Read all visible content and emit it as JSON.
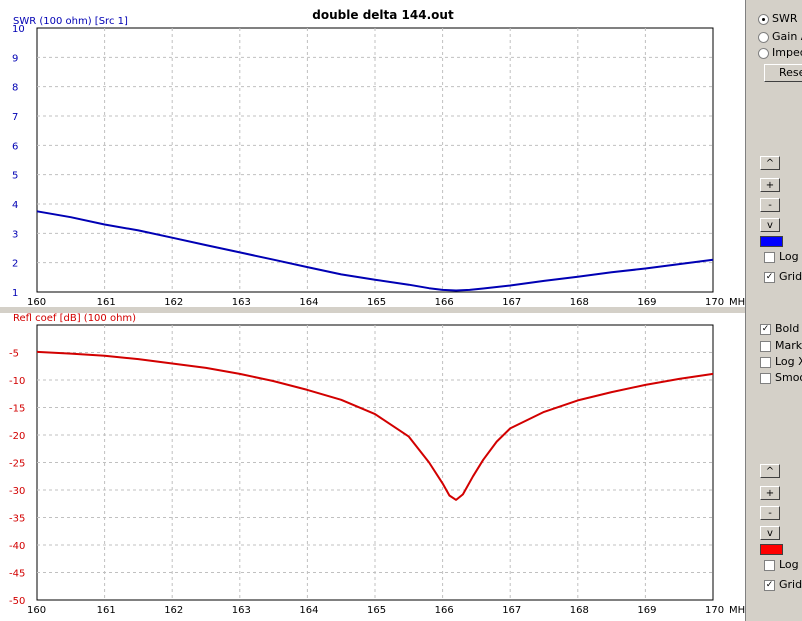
{
  "title": "double delta 144.out",
  "chart_data": [
    {
      "type": "line",
      "ylabel": "SWR (100 ohm) [Src 1]",
      "xunit": "MHz",
      "xlim": [
        160,
        170
      ],
      "ylim": [
        1,
        10
      ],
      "xticks": [
        160,
        161,
        162,
        163,
        164,
        165,
        166,
        167,
        168,
        169,
        170
      ],
      "yticks": [
        1,
        2,
        3,
        4,
        5,
        6,
        7,
        8,
        9,
        10
      ],
      "grid": true,
      "color": "#0000b4",
      "x": [
        160,
        160.5,
        161,
        161.5,
        162,
        162.5,
        163,
        163.5,
        164,
        164.5,
        165,
        165.5,
        165.8,
        166,
        166.2,
        166.4,
        166.6,
        167,
        167.5,
        168,
        168.5,
        169,
        169.5,
        170
      ],
      "y": [
        3.75,
        3.55,
        3.3,
        3.1,
        2.85,
        2.6,
        2.35,
        2.1,
        1.85,
        1.6,
        1.42,
        1.25,
        1.13,
        1.07,
        1.05,
        1.07,
        1.12,
        1.22,
        1.38,
        1.52,
        1.67,
        1.8,
        1.95,
        2.1
      ]
    },
    {
      "type": "line",
      "ylabel": "Refl coef [dB] (100 ohm)",
      "xunit": "MHz",
      "xlim": [
        160,
        170
      ],
      "ylim": [
        -50,
        0
      ],
      "xticks": [
        160,
        161,
        162,
        163,
        164,
        165,
        166,
        167,
        168,
        169,
        170
      ],
      "yticks": [
        -5,
        -10,
        -15,
        -20,
        -25,
        -30,
        -35,
        -40,
        -45,
        -50
      ],
      "grid": true,
      "color": "#d20000",
      "x": [
        160,
        160.5,
        161,
        161.5,
        162,
        162.5,
        163,
        163.5,
        164,
        164.5,
        165,
        165.5,
        165.8,
        166,
        166.1,
        166.2,
        166.3,
        166.45,
        166.6,
        166.8,
        167,
        167.5,
        168,
        168.5,
        169,
        169.5,
        170
      ],
      "y": [
        -4.9,
        -5.2,
        -5.6,
        -6.2,
        -7.0,
        -7.8,
        -8.9,
        -10.2,
        -11.8,
        -13.6,
        -16.2,
        -20.3,
        -25.0,
        -28.8,
        -31.0,
        -31.8,
        -30.8,
        -27.5,
        -24.5,
        -21.2,
        -18.8,
        -15.8,
        -13.7,
        -12.2,
        -10.9,
        -9.8,
        -8.9
      ]
    }
  ],
  "controls": {
    "radio_swr": "SWR",
    "radio_gain": "Gain A",
    "radio_imped": "Imped",
    "reset": "Reset",
    "btn_up": "^",
    "btn_plus": "+",
    "btn_minus": "-",
    "btn_down": "v",
    "log": "Log",
    "grid": "Grid",
    "bold": "Bold",
    "mark": "Mark",
    "logx": "Log X",
    "smooth": "Smoo",
    "swatch_top": "#0000ff",
    "swatch_bottom": "#ff0000"
  }
}
